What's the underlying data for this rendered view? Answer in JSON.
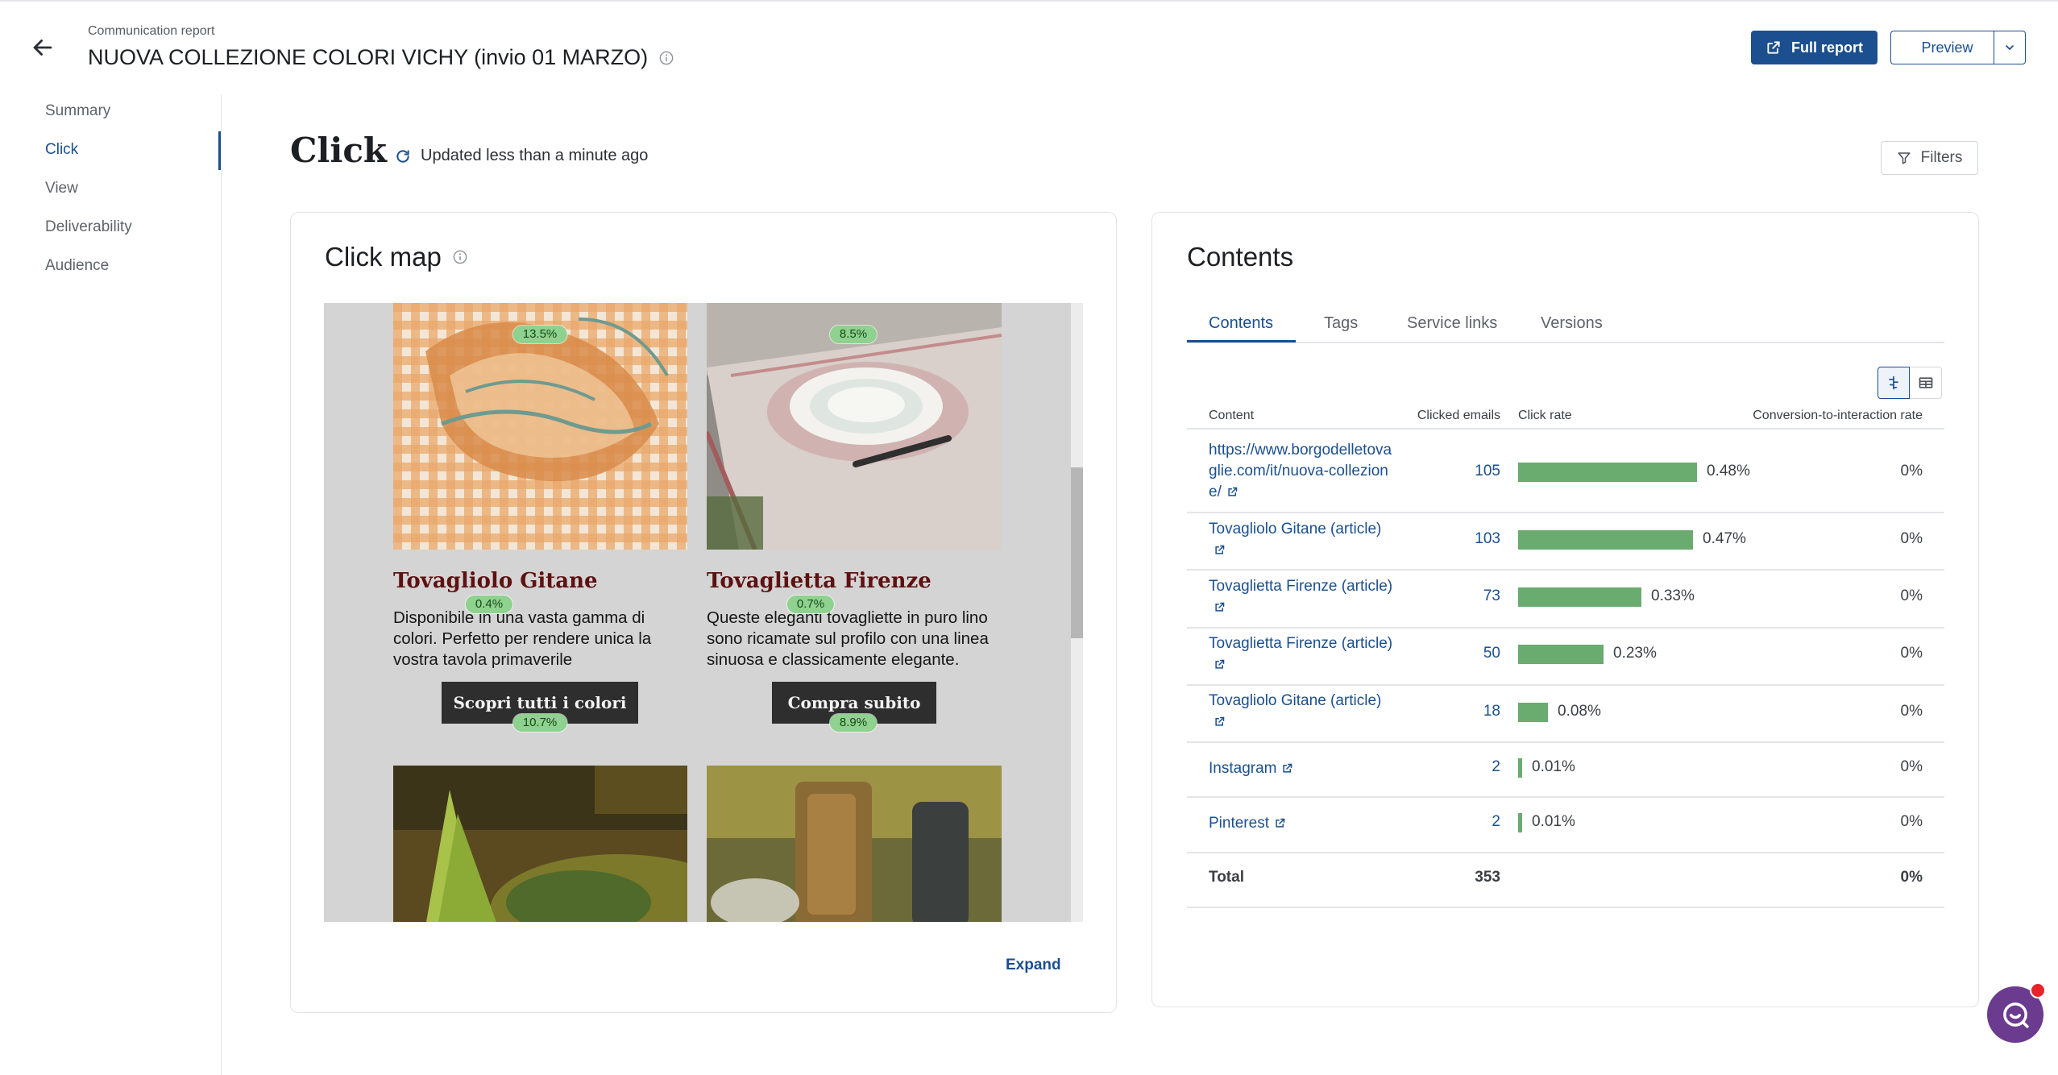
{
  "header": {
    "eyebrow": "Communication report",
    "title": "NUOVA COLLEZIONE COLORI VICHY (invio 01 MARZO)",
    "full_report_label": "Full report",
    "preview_label": "Preview"
  },
  "sidebar": {
    "items": [
      {
        "label": "Summary"
      },
      {
        "label": "Click"
      },
      {
        "label": "View"
      },
      {
        "label": "Deliverability"
      },
      {
        "label": "Audience"
      }
    ]
  },
  "section": {
    "title": "Click",
    "updated": "Updated less than a minute ago",
    "filters_label": "Filters"
  },
  "clickmap": {
    "title": "Click map",
    "expand_label": "Expand",
    "products": [
      {
        "title": "Tovagliolo Gitane",
        "description": "Disponibile in una vasta gamma di colori. Perfetto per rendere unica la vostra tavola primaverile",
        "cta": "Scopri tutti i colori",
        "image_pct": "13.5%",
        "title_pct": "0.4%",
        "cta_pct": "10.7%"
      },
      {
        "title": "Tovaglietta Firenze",
        "description": "Queste eleganti tovagliette in puro lino sono ricamate sul profilo con una linea sinuosa e classicamente elegante.",
        "cta": "Compra subito",
        "image_pct": "8.5%",
        "title_pct": "0.7%",
        "cta_pct": "8.9%"
      }
    ]
  },
  "contents": {
    "title": "Contents",
    "tabs": [
      {
        "label": "Contents"
      },
      {
        "label": "Tags"
      },
      {
        "label": "Service links"
      },
      {
        "label": "Versions"
      }
    ],
    "columns": {
      "content": "Content",
      "clicked": "Clicked emails",
      "rate": "Click rate",
      "conversion": "Conversion-to-interaction rate"
    },
    "rows": [
      {
        "content": "https://www.borgodelletovaglie.com/it/nuova-collezione/",
        "clicked": "105",
        "rate_label": "0.48%",
        "rate": 0.48,
        "conversion": "0%"
      },
      {
        "content": "Tovagliolo Gitane (article)",
        "clicked": "103",
        "rate_label": "0.47%",
        "rate": 0.47,
        "conversion": "0%"
      },
      {
        "content": "Tovaglietta Firenze (article)",
        "clicked": "73",
        "rate_label": "0.33%",
        "rate": 0.33,
        "conversion": "0%"
      },
      {
        "content": "Tovaglietta Firenze (article)",
        "clicked": "50",
        "rate_label": "0.23%",
        "rate": 0.23,
        "conversion": "0%"
      },
      {
        "content": "Tovagliolo Gitane (article)",
        "clicked": "18",
        "rate_label": "0.08%",
        "rate": 0.08,
        "conversion": "0%"
      },
      {
        "content": "Instagram",
        "clicked": "2",
        "rate_label": "0.01%",
        "rate": 0.01,
        "conversion": "0%"
      },
      {
        "content": "Pinterest",
        "clicked": "2",
        "rate_label": "0.01%",
        "rate": 0.01,
        "conversion": "0%"
      }
    ],
    "total": {
      "label": "Total",
      "clicked": "353",
      "conversion": "0%"
    }
  },
  "colors": {
    "primary": "#1b4f8f",
    "bar": "#6aab6f",
    "badge": "#8fd18f",
    "product_title": "#5e1111",
    "chat": "#6b3b8f"
  }
}
